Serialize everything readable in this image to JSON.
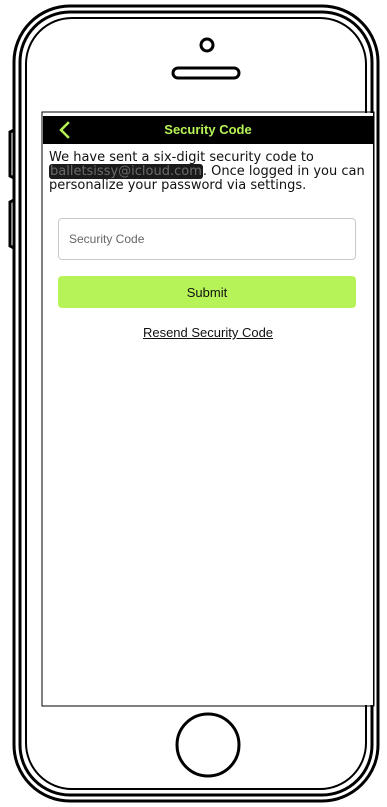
{
  "screen": {
    "title": "Security Code",
    "message": {
      "before": "We have sent a six-digit security code to ",
      "email": "balletsissy@icloud.com",
      "after": ". Once logged in you can personalize your password via settings."
    },
    "input": {
      "placeholder": "Security Code",
      "value": ""
    },
    "submit_label": "Submit",
    "resend_label": "Resend Security Code"
  },
  "icons": {
    "back": "chevron-left-icon"
  },
  "colors": {
    "accent": "#b6f356",
    "nav_bg": "#000000",
    "text": "#111111"
  }
}
